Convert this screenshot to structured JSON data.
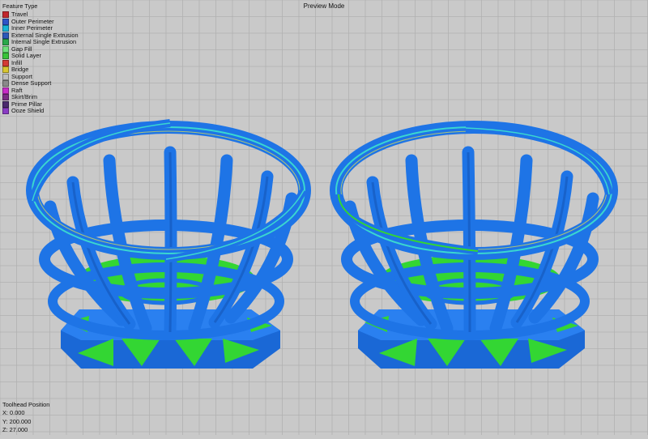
{
  "header": {
    "mode_title": "Preview Mode"
  },
  "legend": {
    "title": "Feature Type",
    "items": [
      {
        "label": "Travel",
        "color": "#c1272d"
      },
      {
        "label": "Outer Perimeter",
        "color": "#2f54c8"
      },
      {
        "label": "Inner Perimeter",
        "color": "#19b3d6"
      },
      {
        "label": "External Single Extrusion",
        "color": "#2c58b8"
      },
      {
        "label": "Internal Single Extrusion",
        "color": "#2aa84a"
      },
      {
        "label": "Gap Fill",
        "color": "#6ee07a"
      },
      {
        "label": "Solid Layer",
        "color": "#38c438"
      },
      {
        "label": "Infill",
        "color": "#d43b34"
      },
      {
        "label": "Bridge",
        "color": "#d9c630"
      },
      {
        "label": "Support",
        "color": "#bdbdbd"
      },
      {
        "label": "Dense Support",
        "color": "#8a8a8a"
      },
      {
        "label": "Raft",
        "color": "#c82cc8"
      },
      {
        "label": "Skirt/Brim",
        "color": "#7a2c84"
      },
      {
        "label": "Prime Pillar",
        "color": "#4b2a6e"
      },
      {
        "label": "Ooze Shield",
        "color": "#8a3cc4"
      }
    ]
  },
  "toolhead": {
    "title": "Toolhead Position",
    "x": "X: 0.000",
    "y": "Y: 200.000",
    "z": "Z: 27.000"
  },
  "colors": {
    "background": "#c9c9c9",
    "grid": "#b1b1b1",
    "model_blue": "#1e74e6",
    "model_blue_dark": "#1456b8",
    "infill_green": "#33d633",
    "perimeter_cyan": "#3ad6d0",
    "bridge_yellow": "#e8e64a"
  }
}
